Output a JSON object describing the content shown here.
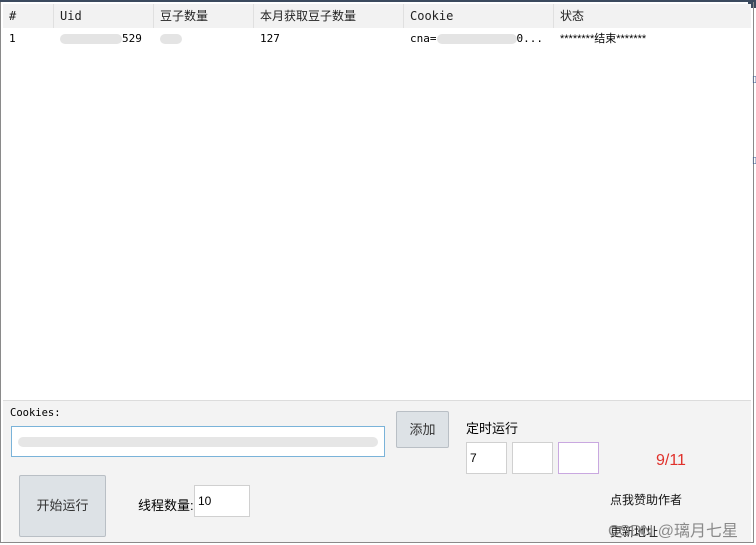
{
  "table": {
    "columns": [
      "#",
      "Uid",
      "豆子数量",
      "本月获取豆子数量",
      "Cookie",
      "状态"
    ],
    "rows": [
      {
        "index": "1",
        "uid": "529",
        "beans": "",
        "monthly_beans": "127",
        "cookie": "cna=",
        "cookie_tail": "0...",
        "status": "********结束*******"
      }
    ]
  },
  "form": {
    "cookies_label": "Cookies:",
    "add_button": "添加",
    "schedule_label": "定时运行",
    "schedule_values": [
      "7",
      "",
      ""
    ],
    "start_button": "开始运行",
    "threads_label": "线程数量:",
    "threads_value": "10",
    "counter": "9/11",
    "sponsor_link": "点我赞助作者",
    "update_link": "更新地址"
  },
  "watermark": "CSDN @璃月七星",
  "colors": {
    "counter": "#e0302a",
    "input_focus_border": "#7ab3d9",
    "selected_box_border": "#c9a8e0"
  }
}
